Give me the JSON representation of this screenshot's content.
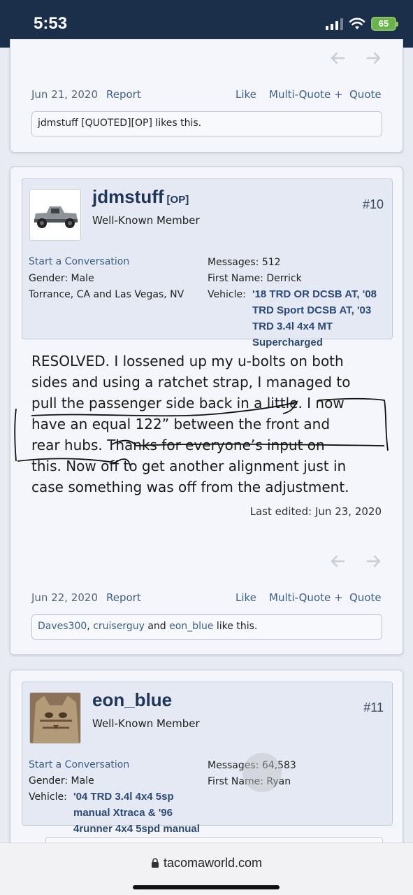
{
  "status_bar": {
    "time": "5:53",
    "battery": "65"
  },
  "posts": [
    {
      "date": "Jun 21, 2020",
      "report_label": "Report",
      "like_label": "Like",
      "multiquote_label": "Multi-Quote +",
      "quote_label": "Quote",
      "likes_text": "jdmstuff [QUOTED][OP] likes this."
    },
    {
      "username": "jdmstuff",
      "op_tag": "[OP]",
      "user_title": "Well-Known Member",
      "post_number": "#10",
      "start_conversation": "Start a Conversation",
      "gender_label": "Gender:",
      "gender": "Male",
      "location": "Torrance, CA and Las Vegas, NV",
      "messages_label": "Messages:",
      "messages": "512",
      "first_name_label": "First Name:",
      "first_name": "Derrick",
      "vehicle_label": "Vehicle:",
      "vehicle_lines": [
        "'18 TRD OR DCSB AT, '08",
        "TRD Sport DCSB AT, '03",
        "TRD 3.4l 4x4 MT",
        "Supercharged"
      ],
      "body_lines": [
        "RESOLVED. I lossened up my u-bolts on both",
        "sides and using a ratchet strap, I managed to",
        "pull the passenger side back in a little. I now",
        "have an equal 122” between the front and",
        "rear hubs. Thanks for everyone’s input on",
        "this. Now off to get another alignment just in",
        "case something was off from the adjustment."
      ],
      "last_edited": "Last edited: Jun 23, 2020",
      "date": "Jun 22, 2020",
      "report_label": "Report",
      "like_label": "Like",
      "multiquote_label": "Multi-Quote +",
      "quote_label": "Quote",
      "likers": [
        "Daves300",
        "cruiserguy",
        "eon_blue"
      ],
      "likes_sep": ", ",
      "likes_and": " and ",
      "likes_suffix": " like this."
    },
    {
      "username": "eon_blue",
      "user_title": "Well-Known Member",
      "post_number": "#11",
      "start_conversation": "Start a Conversation",
      "gender_label": "Gender:",
      "gender": "Male",
      "messages_label": "Messages:",
      "messages": "64,583",
      "first_name_label": "First Name:",
      "first_name": "Ryan",
      "vehicle_label": "Vehicle:",
      "vehicle_lines": [
        "'04 TRD 3.4l 4x4 5sp",
        "manual Xtraca & '96",
        "4runner 4x4 5spd manual"
      ]
    }
  ],
  "browser": {
    "url": "tacomaworld.com"
  },
  "colors": {
    "header_bg": "#1b2f4b",
    "link": "#3d5f87",
    "username": "#1e3558",
    "vehicle": "#2b4a77"
  }
}
